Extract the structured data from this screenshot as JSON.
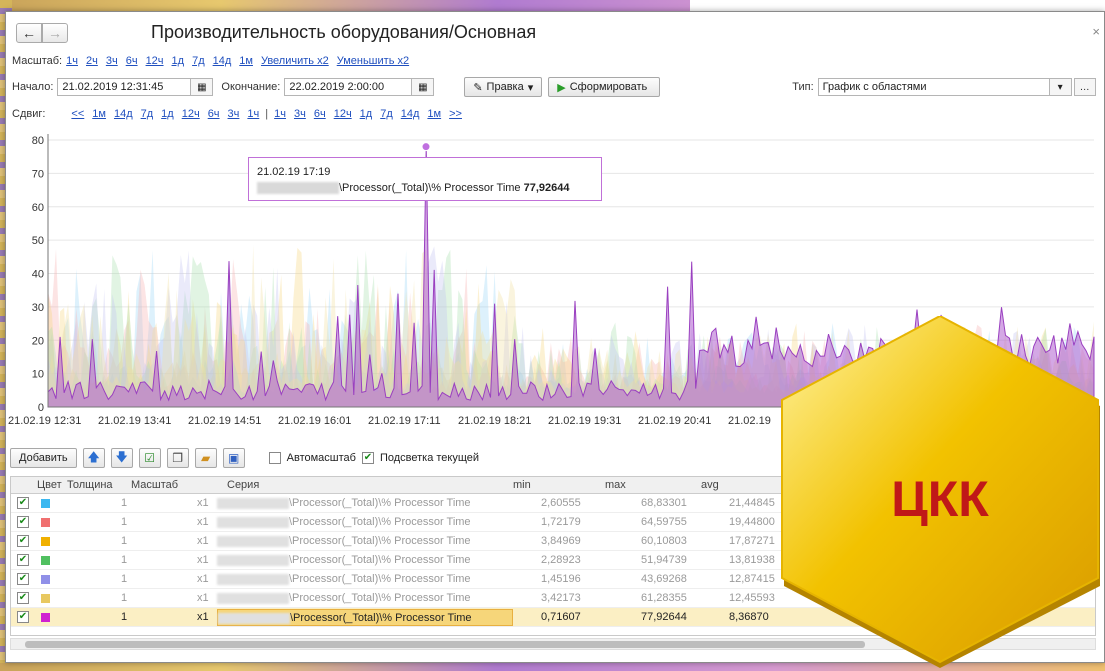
{
  "window": {
    "title": "Производительность оборудования/Основная",
    "back_icon": "←",
    "forward_icon": "→",
    "close_icon": "×"
  },
  "scale": {
    "label": "Масштаб:",
    "links": [
      "1ч",
      "2ч",
      "3ч",
      "6ч",
      "12ч",
      "1д",
      "7д",
      "14д",
      "1м",
      "Увеличить x2",
      "Уменьшить x2"
    ]
  },
  "period": {
    "start_label": "Начало:",
    "start_value": "21.02.2019 12:31:45",
    "end_label": "Окончание:",
    "end_value": "22.02.2019 2:00:00",
    "edit_button": "Правка",
    "generate_button": "Сформировать",
    "type_label": "Тип:",
    "type_value": "График с областями"
  },
  "shift": {
    "label": "Сдвиг:",
    "back": [
      "<<",
      "1м",
      "14д",
      "7д",
      "1д",
      "12ч",
      "6ч",
      "3ч",
      "1ч"
    ],
    "forward": [
      "1ч",
      "3ч",
      "6ч",
      "12ч",
      "1д",
      "7д",
      "14д",
      "1м",
      ">>"
    ]
  },
  "tooltip": {
    "time": "21.02.19 17:19",
    "series": "\\Processor(_Total)\\% Processor Time",
    "value": "77,92644"
  },
  "chart_data": {
    "type": "area",
    "y_ticks": [
      "0",
      "10",
      "20",
      "30",
      "40",
      "50",
      "60",
      "70",
      "80"
    ],
    "ylim": [
      0,
      80
    ],
    "x_ticks": [
      "21.02.19 12:31",
      "21.02.19 13:41",
      "21.02.19 14:51",
      "21.02.19 16:01",
      "21.02.19 17:11",
      "21.02.19 18:21",
      "21.02.19 19:31",
      "21.02.19 20:41",
      "21.02.19"
    ],
    "highlight_color": "#b060d0",
    "grid": true
  },
  "actions": {
    "add_button": "Добавить",
    "autoscale_label": "Автомасштаб",
    "highlight_label": "Подсветка текущей"
  },
  "table": {
    "headers": {
      "color": "Цвет",
      "thickness": "Толщина",
      "scale": "Масштаб",
      "series": "Серия",
      "min": "min",
      "max": "max",
      "avg": "avg"
    },
    "rows": [
      {
        "color": "#3cb8f0",
        "thickness": "1",
        "scale": "x1",
        "series": "\\Processor(_Total)\\% Processor Time",
        "min": "2,60555",
        "max": "68,83301",
        "avg": "21,44845"
      },
      {
        "color": "#f07070",
        "thickness": "1",
        "scale": "x1",
        "series": "\\Processor(_Total)\\% Processor Time",
        "min": "1,72179",
        "max": "64,59755",
        "avg": "19,44800"
      },
      {
        "color": "#f0b000",
        "thickness": "1",
        "scale": "x1",
        "series": "\\Processor(_Total)\\% Processor Time",
        "min": "3,84969",
        "max": "60,10803",
        "avg": "17,87271"
      },
      {
        "color": "#50c060",
        "thickness": "1",
        "scale": "x1",
        "series": "\\Processor(_Total)\\% Processor Time",
        "min": "2,28923",
        "max": "51,94739",
        "avg": "13,81938"
      },
      {
        "color": "#9090e8",
        "thickness": "1",
        "scale": "x1",
        "series": "\\Processor(_Total)\\% Processor Time",
        "min": "1,45196",
        "max": "43,69268",
        "avg": "12,87415"
      },
      {
        "color": "#e8c860",
        "thickness": "1",
        "scale": "x1",
        "series": "\\Processor(_Total)\\% Processor Time",
        "min": "3,42173",
        "max": "61,28355",
        "avg": "12,45593"
      },
      {
        "color": "#d020d0",
        "thickness": "1",
        "scale": "x1",
        "series": "\\Processor(_Total)\\% Processor Time",
        "min": "0,71607",
        "max": "77,92644",
        "avg": "8,36870"
      }
    ]
  },
  "badge": {
    "text": "ЦКК"
  }
}
